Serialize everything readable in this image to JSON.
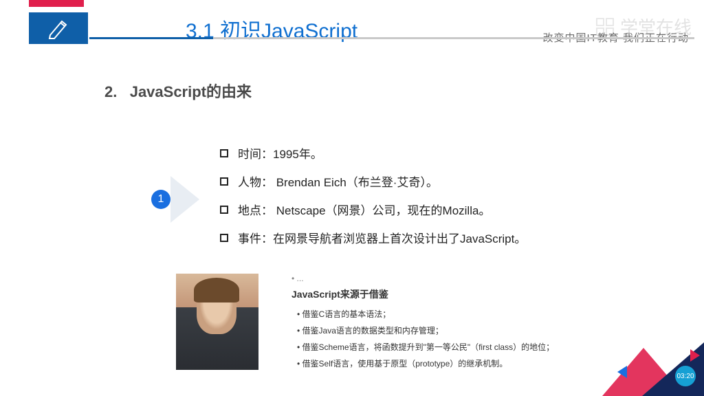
{
  "header": {
    "title": "3.1 初识JavaScript",
    "tagline": "改变中国IT教育 我们正在行动",
    "watermark": "学堂在线"
  },
  "section": {
    "number": "2.",
    "heading": "JavaScript的由来"
  },
  "badge": {
    "number": "1"
  },
  "bullets": [
    "时间：1995年。",
    "人物： Brendan Eich（布兰登·艾奇）。",
    "地点： Netscape（网景）公司，现在的Mozilla。",
    "事件：在网景导航者浏览器上首次设计出了JavaScript。"
  ],
  "card": {
    "dots": "• ...",
    "title": "JavaScript来源于借鉴",
    "items": [
      "借鉴C语言的基本语法；",
      "借鉴Java语言的数据类型和内存管理；",
      "借鉴Scheme语言，将函数提升到\"第一等公民\"（first class）的地位；",
      "借鉴Self语言，使用基于原型（prototype）的继承机制。"
    ]
  },
  "timestamp": "03:20"
}
